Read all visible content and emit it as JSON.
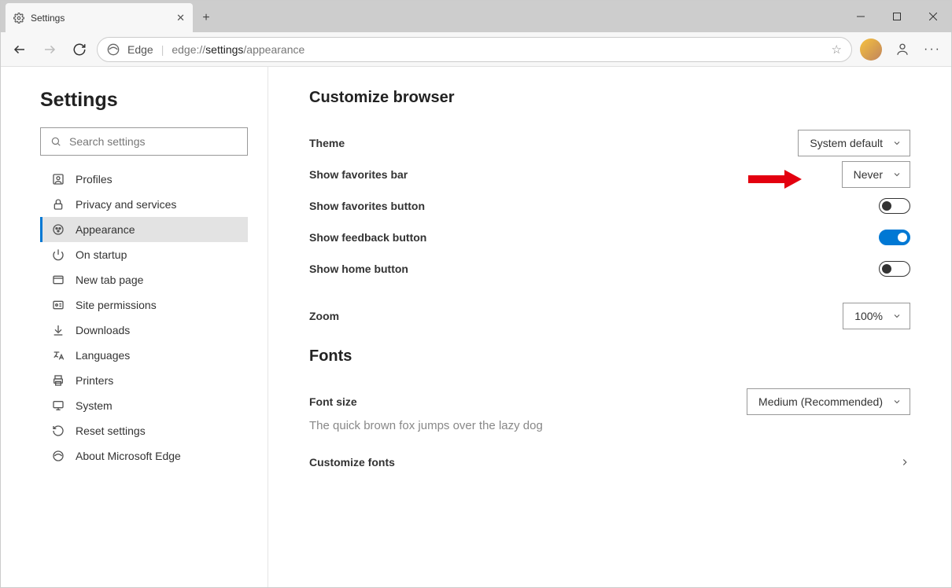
{
  "tab": {
    "title": "Settings"
  },
  "addressbar": {
    "protocol_label": "Edge",
    "url_prefix": "edge://",
    "url_bold": "settings",
    "url_suffix": "/appearance"
  },
  "sidebar": {
    "title": "Settings",
    "search_placeholder": "Search settings",
    "items": [
      {
        "label": "Profiles"
      },
      {
        "label": "Privacy and services"
      },
      {
        "label": "Appearance"
      },
      {
        "label": "On startup"
      },
      {
        "label": "New tab page"
      },
      {
        "label": "Site permissions"
      },
      {
        "label": "Downloads"
      },
      {
        "label": "Languages"
      },
      {
        "label": "Printers"
      },
      {
        "label": "System"
      },
      {
        "label": "Reset settings"
      },
      {
        "label": "About Microsoft Edge"
      }
    ]
  },
  "sections": {
    "customize_title": "Customize browser",
    "theme_label": "Theme",
    "theme_value": "System default",
    "favorites_bar_label": "Show favorites bar",
    "favorites_bar_value": "Never",
    "favorites_button_label": "Show favorites button",
    "feedback_button_label": "Show feedback button",
    "home_button_label": "Show home button",
    "zoom_label": "Zoom",
    "zoom_value": "100%",
    "fonts_title": "Fonts",
    "font_size_label": "Font size",
    "font_size_value": "Medium (Recommended)",
    "font_sample": "The quick brown fox jumps over the lazy dog",
    "customize_fonts_label": "Customize fonts"
  }
}
